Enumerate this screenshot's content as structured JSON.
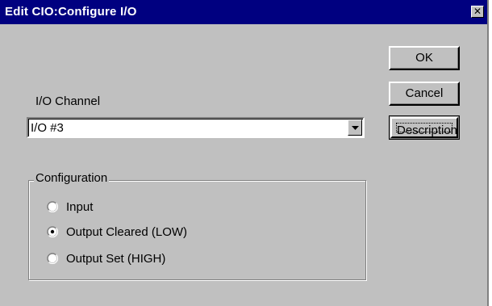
{
  "window": {
    "title": "Edit CIO:Configure I/O",
    "close_glyph": "✕"
  },
  "buttons": {
    "ok": "OK",
    "cancel": "Cancel",
    "description": "Description"
  },
  "io_channel": {
    "label": "I/O Channel",
    "selected": "I/O #3"
  },
  "configuration": {
    "title": "Configuration",
    "options": [
      {
        "label": "Input",
        "selected": false
      },
      {
        "label": "Output Cleared (LOW)",
        "selected": true
      },
      {
        "label": "Output Set (HIGH)",
        "selected": false
      }
    ]
  },
  "icons": {
    "close": "close-icon",
    "dropdown": "chevron-down-icon"
  }
}
